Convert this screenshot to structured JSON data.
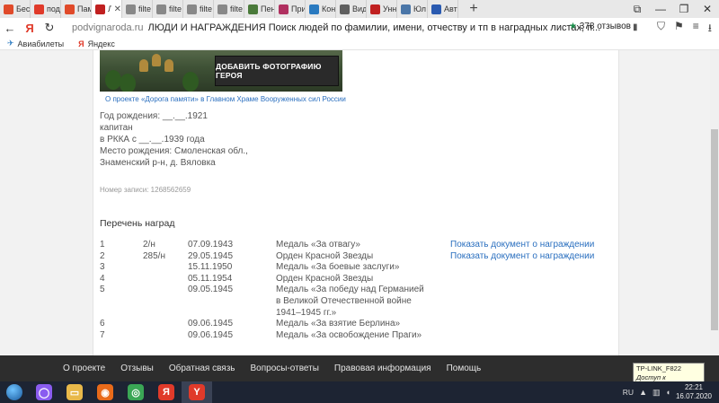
{
  "browser": {
    "tabs": [
      {
        "label": "Бес",
        "icon": "star-icon",
        "color": "#e04a2a"
      },
      {
        "label": "под",
        "icon": "yandex-icon",
        "color": "#e03a2a"
      },
      {
        "label": "Пам",
        "icon": "star-icon",
        "color": "#e04a2a"
      },
      {
        "label": "Л",
        "icon": "site-icon",
        "color": "#c02020",
        "active": true
      },
      {
        "label": "filte",
        "icon": "doc-icon",
        "color": "#888888"
      },
      {
        "label": "filte",
        "icon": "doc-icon",
        "color": "#888888"
      },
      {
        "label": "filte",
        "icon": "doc-icon",
        "color": "#888888"
      },
      {
        "label": "filte",
        "icon": "doc-icon",
        "color": "#888888"
      },
      {
        "label": "Пен",
        "icon": "doc-icon",
        "color": "#4a7a3a"
      },
      {
        "label": "При",
        "icon": "site-icon",
        "color": "#b03060"
      },
      {
        "label": "Кон",
        "icon": "site-icon",
        "color": "#2a7ac0"
      },
      {
        "label": "Вид",
        "icon": "site-icon",
        "color": "#606060"
      },
      {
        "label": "Унн",
        "icon": "site-icon",
        "color": "#c02020"
      },
      {
        "label": "Юл",
        "icon": "vk-icon",
        "color": "#4a76a8"
      },
      {
        "label": "Авт",
        "icon": "flag-icon",
        "color": "#2a5ab0"
      }
    ],
    "new_tab": "+",
    "window_controls": [
      "⧉",
      "—",
      "❐",
      "✕"
    ],
    "address": {
      "domain": "podvignaroda.ru",
      "title": "ЛЮДИ И НАГРАЖДЕНИЯ Поиск людей по фамилии, имени, отчеству и тп в наградных листах, п...",
      "reviews": "378 отзывов",
      "star": "★"
    },
    "nav": {
      "back": "←",
      "logo": "Я",
      "refresh": "↻"
    },
    "bookmarks": [
      {
        "label": "Авиабилеты",
        "icon": "plane-icon"
      },
      {
        "label": "Яндекс",
        "icon": "yandex-icon"
      }
    ]
  },
  "page": {
    "hero_button": "ДОБАВИТЬ ФОТОГРАФИЮ ГЕРОЯ",
    "hero_caption": "О проекте «Дорога памяти» в Главном Храме Вооруженных сил России",
    "bio": [
      "Год рождения: __.__.1921",
      "капитан",
      "в РККА с __.__.1939 года",
      "Место рождения: Смоленская обл.,",
      "Знаменский р-н, д. Вяловка"
    ],
    "record_number": "Номер записи: 1268562659",
    "awards_title": "Перечень наград",
    "awards": [
      {
        "n": "1",
        "no": "2/н",
        "date": "07.09.1943",
        "name": "Медаль «За отвагу»",
        "link": "Показать документ о награждении"
      },
      {
        "n": "2",
        "no": "285/н",
        "date": "29.05.1945",
        "name": "Орден Красной Звезды",
        "link": "Показать документ о награждении"
      },
      {
        "n": "3",
        "no": "",
        "date": "15.11.1950",
        "name": "Медаль «За боевые заслуги»",
        "link": ""
      },
      {
        "n": "4",
        "no": "",
        "date": "05.11.1954",
        "name": "Орден Красной Звезды",
        "link": ""
      },
      {
        "n": "5",
        "no": "",
        "date": "09.05.1945",
        "name": "Медаль «За победу над Германией в Великой Отечественной войне 1941–1945 гг.»",
        "link": ""
      },
      {
        "n": "6",
        "no": "",
        "date": "09.06.1945",
        "name": "Медаль «За взятие Берлина»",
        "link": ""
      },
      {
        "n": "7",
        "no": "",
        "date": "09.06.1945",
        "name": "Медаль «За освобождение Праги»",
        "link": ""
      }
    ]
  },
  "footer": {
    "links": [
      "О проекте",
      "Отзывы",
      "Обратная связь",
      "Вопросы-ответы",
      "Правовая информация",
      "Помощь"
    ]
  },
  "tooltip": {
    "line1": "TP-LINK_F822",
    "line2": "Доступ к Интернету"
  },
  "taskbar": {
    "apps": [
      {
        "name": "alice-icon",
        "color": "#8a5cf0",
        "glyph": "◯"
      },
      {
        "name": "explorer-icon",
        "color": "#e8b84a",
        "glyph": "▭"
      },
      {
        "name": "firefox-icon",
        "color": "#e86a1a",
        "glyph": "◉"
      },
      {
        "name": "chrome-icon",
        "color": "#3aa655",
        "glyph": "◎"
      },
      {
        "name": "yandex-browser-icon",
        "color": "#e03a2a",
        "glyph": "Я"
      },
      {
        "name": "yandex-y-icon",
        "color": "#e03a2a",
        "glyph": "Y",
        "active": true
      }
    ],
    "lang": "RU",
    "time": "22:21",
    "date": "16.07.2020"
  },
  "colors": {
    "link": "#2a6fbf",
    "footer_bg": "#2d2d2d",
    "taskbar_bg": "#1d2433"
  }
}
